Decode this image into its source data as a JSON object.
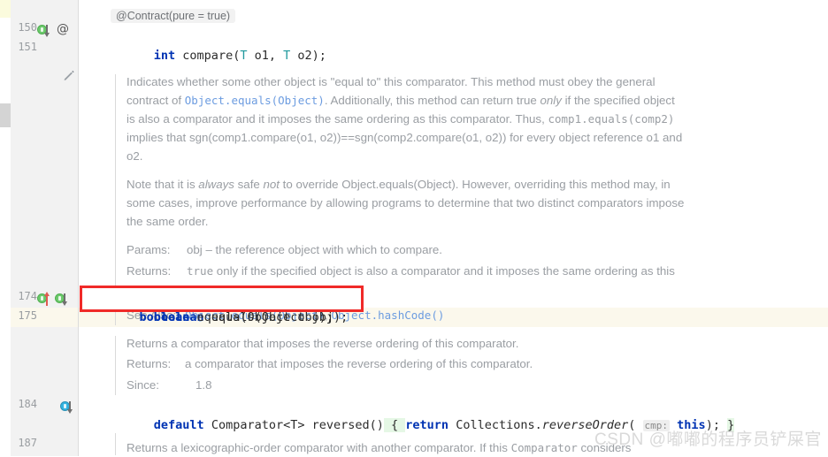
{
  "editor": {
    "annotation_line": "@Contract(pure = true)",
    "watermark": "CSDN @嘟嘟的程序员铲屎官"
  },
  "gutter": {
    "lines": [
      {
        "number": "150",
        "icons": [
          "implemented-down-marker",
          "annotation-at-icon"
        ]
      },
      {
        "number": "151",
        "icons": [
          "edit-pencil-icon"
        ]
      },
      {
        "number": "174",
        "icons": [
          "overrides-up-marker",
          "overridden-down-marker"
        ]
      },
      {
        "number": "175",
        "icons": []
      },
      {
        "number": "184",
        "icons": [
          "implementing-down-marker",
          "fold-expand-icon"
        ]
      },
      {
        "number": "187",
        "icons": []
      }
    ],
    "at_symbol": "@"
  },
  "code": {
    "compare_signature": {
      "keyword": "int",
      "method": " compare(",
      "type1": "T",
      "param1": " o1, ",
      "type2": "T",
      "param2": " o2);",
      "full": "int compare(T o1, T o2);"
    },
    "equals_signature": {
      "keyword": "boolean",
      "rest": " equals(Object obj);",
      "full": "boolean equals(Object obj);"
    },
    "reversed_signature": {
      "kw_default": "default",
      "type": " Comparator<T> ",
      "method": "reversed()",
      "brace_open": " { ",
      "kw_return": "return",
      "call_class": " Collections.",
      "call_method": "reverseOrder",
      "paren": "( ",
      "hint": "cmp:",
      "kw_this": " this",
      "tail": "); ",
      "brace_close": "}",
      "full": "default Comparator<T> reversed() { return Collections.reverseOrder( cmp: this); }"
    }
  },
  "doc_equals": {
    "paragraph1": {
      "part1": "Indicates whether some other object is \"equal to\" this comparator. This method must obey the general contract of ",
      "link1": "Object.equals(Object)",
      "part2": ". Additionally, this method can return true ",
      "italic1": "only",
      "part3": " if the specified object is also a comparator and it imposes the same ordering as this comparator. Thus, ",
      "mono1": "comp1.equals(comp2)",
      "part4": " implies that sgn(comp1.compare(o1, o2))==sgn(comp2.compare(o1, o2)) for every object reference o1 and o2."
    },
    "paragraph2": {
      "part1": "Note that it is ",
      "italic1": "always",
      "part2": " safe ",
      "italic2": "not",
      "part3": " to override Object.equals(Object). However, overriding this method may, in some cases, improve performance by allowing programs to determine that two distinct comparators impose the same order."
    },
    "params": {
      "label": "Params:",
      "value": "obj – the reference object with which to compare."
    },
    "returns": {
      "label": "Returns:",
      "mono_value": "true",
      "value": " only if the specified object is also a comparator and it imposes the same ordering as this comparator."
    },
    "see_also": {
      "label": "See Also:",
      "link1": "Object.equals(Object)",
      "separator": ", ",
      "link2": "Object.hashCode()"
    }
  },
  "doc_reversed": {
    "summary": "Returns a comparator that imposes the reverse ordering of this comparator.",
    "returns": {
      "label": "Returns:",
      "value": "a comparator that imposes the reverse ordering of this comparator."
    },
    "since": {
      "label": "Since:",
      "value": "1.8"
    }
  },
  "doc_thencomparing": {
    "part1": "Returns a lexicographic-order comparator with another comparator. If this ",
    "mono1": "Comparator",
    "part2": " considers"
  },
  "colors": {
    "keyword": "#0033b3",
    "type_param": "#20999d",
    "doc_text": "#9a9ea3",
    "doc_link": "#6c9ce0",
    "highlight_box": "#f02a28",
    "caret_row": "#fbf8ec",
    "gutter_bg": "#f2f2f2"
  }
}
